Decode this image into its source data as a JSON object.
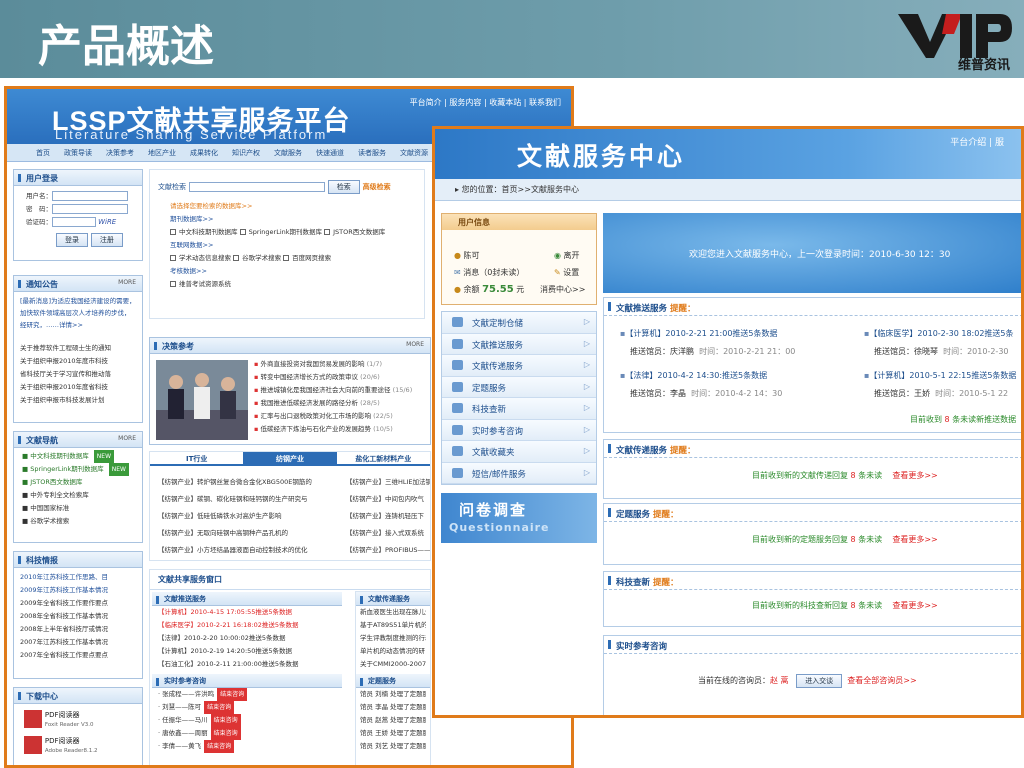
{
  "slide": {
    "title": "产品概述",
    "logo_text": "维普资讯",
    "logo_letters": "VIP"
  },
  "w1": {
    "title": "LSSP文献共享服务平台",
    "subtitle": "Literature  Sharing  Service  Platform",
    "toplinks": "平台简介 | 服务内容 | 收藏本站 | 联系我们",
    "nav": [
      "首页",
      "政策导读",
      "决策参考",
      "地区产业",
      "成果转化",
      "知识产权",
      "文献服务",
      "快速通道",
      "读者服务",
      "文献资源"
    ],
    "login": {
      "title": "用户登录",
      "username": "用户名：",
      "password": "密　码：",
      "captcha": "验证码：",
      "captcha_img": "WiRE",
      "login_btn": "登录",
      "register_btn": "注册"
    },
    "search": {
      "label": "文献检索",
      "btn": "检索",
      "adv": "高级检索",
      "hint": "请选择您要检索的数据库>>",
      "periodical": "期刊数据库>>",
      "db1": "中文科技期刊数据库",
      "db2": "SpringerLink期刊数据库",
      "db3": "JSTOR西文数据库",
      "web": "互联网数据>>",
      "w1": "学术动态信息搜索",
      "w2": "谷歌学术搜索",
      "w3": "百度网页搜索",
      "exam": "考核数据>>",
      "e1": "维普考试资源系统"
    },
    "notice": {
      "title": "通知公告",
      "more": "MORE",
      "headline": "[最新消息]为适应我国经济建设的需要，加快软件领域高层次人才培养的步伐，经研究，……详情>>",
      "items": [
        "关于推荐软件工程硕士生的通知",
        "关于组织申报2010年度市科技",
        "省科技厅关于学习宣传和推动落",
        "关于组织申报2010年度省科技",
        "关于组织申报市科技发展计划"
      ]
    },
    "nav2": {
      "title": "文献导航",
      "more": "MORE",
      "items": [
        "中文科技期刊数据库",
        "SpringerLink期刊数据库",
        "JSTOR西文数据库",
        "中外专利全文检索库",
        "中国国家标准",
        "谷歌学术搜索"
      ],
      "new": "NEW"
    },
    "sci": {
      "title": "科技情报",
      "items": [
        "2010年江苏科技工作思路、目",
        "2009年江苏科技工作基本情况",
        "2009年全省科技工作要作要点",
        "2008年全省科技工作基本情况",
        "2008年上半年省科技厅或情况",
        "2007年江苏科技工作基本情况",
        "2007年全省科技工作要点要点"
      ]
    },
    "download": {
      "title": "下载中心",
      "reader1": "PDF阅读器",
      "reader1_sub": "Foxit Reader V3.0",
      "reader2": "PDF阅读器",
      "reader2_sub": "Adobe Reader8.1.2"
    },
    "decision": {
      "title": "决策参考",
      "more": "MORE",
      "items": [
        {
          "t": "外商直接投资对我国贸易发展的影响",
          "d": "(1/7)"
        },
        {
          "t": "转变中国经济增长方式的政策审议",
          "d": "(20/6)"
        },
        {
          "t": "推进城镇化是我国经济社会大向前的重要途径",
          "d": "(15/6)"
        },
        {
          "t": "我国推进低碳经济发展的路径分析",
          "d": "(28/5)"
        },
        {
          "t": "汇率与出口退税政策对化工市场的影响",
          "d": "(22/5)"
        },
        {
          "t": "低碳经济下炼油与石化产业的发展趋势",
          "d": "(10/5)"
        }
      ]
    },
    "industry": {
      "tabs": [
        "IT行业",
        "纺钢产业",
        "盐化工新材料产业"
      ],
      "left": [
        "【纺钢产业】转炉钢丝复合微合金化XBG500E钢筋的",
        "【纺钢产业】碳钢、碳化硅钢和硅钙钢的生产研究与",
        "【纺钢产业】低硅低磷铁水对高炉生产影响",
        "【纺钢产业】无取向硅钢中高钢种产品孔机的",
        "【纺钢产业】小方坯结晶器液面自动控制技术的优化"
      ],
      "right": [
        "【纺钢产业】三维HLIE加法钢",
        "【纺钢产业】中间包内吹气",
        "【纺钢产业】连铸机轻压下",
        "【纺钢产业】接入式双系统",
        "【纺钢产业】PROFIBUS——"
      ]
    },
    "window": {
      "title": "文献共享服务窗口",
      "push_title": "文献推送服务",
      "push": [
        {
          "t": "【计算机】2010-4-15 17:05:55推送5条数据",
          "c": "red"
        },
        {
          "t": "【临床医学】2010-2-21 16:18:02推送5条数据",
          "c": "red"
        },
        {
          "t": "【法律】2010-2-20 10:00:02推送5条数据",
          "c": "normal"
        },
        {
          "t": "【计算机】2010-2-19 14:20:50推送5条数据",
          "c": "normal"
        },
        {
          "t": "【石油工化】2010-2-11 21:00:00推送5条数据",
          "c": "normal"
        }
      ],
      "deliver_title": "文献传递服务",
      "deliver": [
        "新血液医生出现在脉儿生",
        "基于AT89S51单片机的文",
        "学生评教制度推测的行动",
        "单片机的动态情况的研",
        "关于CMMI2000-2007年收"
      ],
      "consult_title": "实时参考咨询",
      "consult": [
        {
          "n": "张成程——许洪鸣",
          "s": "结束咨询"
        },
        {
          "n": "刘慧——陈可",
          "s": "结束咨询"
        },
        {
          "n": "任振华——马川",
          "s": "结束咨询"
        },
        {
          "n": "唐依鑫——周丽",
          "s": "结束咨询"
        },
        {
          "n": "李倩——黄飞",
          "s": "结束咨询"
        }
      ],
      "topic_title": "定题服务",
      "topic": [
        "馆员 刘楠 处理了定题服务：请教外文期刊检索问题",
        "馆员 李晶 处理了定题服务：关于IPv6研究的最新文章",
        "馆员 赵蒿 处理了定题服务：关于IPv6研究的最新文章",
        "馆员 王娇 处理了定题服务：转变中国经济增长方式的政策",
        "馆员 刘艺 处理了定题服务：高新技术企业认定管理工作"
      ]
    }
  },
  "w2": {
    "title": "文献服务中心",
    "toplink": "平台介绍 | 服",
    "crumb": "您的位置：首页>>文献服务中心",
    "user": {
      "title": "用户信息",
      "name": "陈可",
      "logout": "离开",
      "msg": "消息（0封未读）",
      "settings": "设置",
      "balance_label": "余额",
      "balance": "75.55",
      "balance_unit": "元",
      "consume": "消费中心>>"
    },
    "menu": [
      "文献定制仓储",
      "文献推送服务",
      "文献传递服务",
      "定题服务",
      "科技查新",
      "实时参考咨询",
      "文献收藏夹",
      "短信/邮件服务"
    ],
    "quest": {
      "cn": "问卷调查",
      "en": "Questionnaire"
    },
    "welcome": "欢迎您进入文献服务中心，上一次登录时间：2010-6-30 12：30",
    "push": {
      "title": "文献推送服务",
      "hint": "提醒：",
      "items": [
        {
          "t": "【计算机】2010-2-21 21:00推送5条数据",
          "by": "推送馆员：庆洋鹏",
          "time": "时间：2010-2-21 21：00"
        },
        {
          "t": "【法律】2010-4-2 14:30:推送5条数据",
          "by": "推送馆员：李晶",
          "time": "时间：2010-4-2 14：30"
        },
        {
          "t": "【临床医学】2010-2-30 18:02推送5条",
          "by": "推送馆员：徐晓琴",
          "time": "时间：2010-2-30"
        },
        {
          "t": "【计算机】2010-5-1 22:15推送5条数据",
          "by": "推送馆员：王娇",
          "time": "时间：2010-5-1 22"
        }
      ],
      "footer_a": "目前收到",
      "footer_n": "8",
      "footer_b": "条未读新推送数据"
    },
    "deliver": {
      "title": "文献传递服务",
      "hint": "提醒：",
      "a": "目前收到新的文献传递回复",
      "n": "8",
      "b": "条未读",
      "more": "查看更多>>"
    },
    "topic": {
      "title": "定题服务",
      "hint": "提醒：",
      "a": "目前收到新的定题服务回复",
      "n": "8",
      "b": "条未读",
      "more": "查看更多>>"
    },
    "novelty": {
      "title": "科技查新",
      "hint": "提醒：",
      "a": "目前收到新的科技查新回复",
      "n": "8",
      "b": "条未读",
      "more": "查看更多>>"
    },
    "consult": {
      "title": "实时参考咨询",
      "online": "当前在线的咨询员：",
      "who": "赵 蒿",
      "btn": "进入交谈",
      "all": "查看全部咨询员>>"
    }
  },
  "colors": {
    "accent": "#e07b1a",
    "header": "#5b8c9a",
    "blue": "#2c6cb5"
  }
}
